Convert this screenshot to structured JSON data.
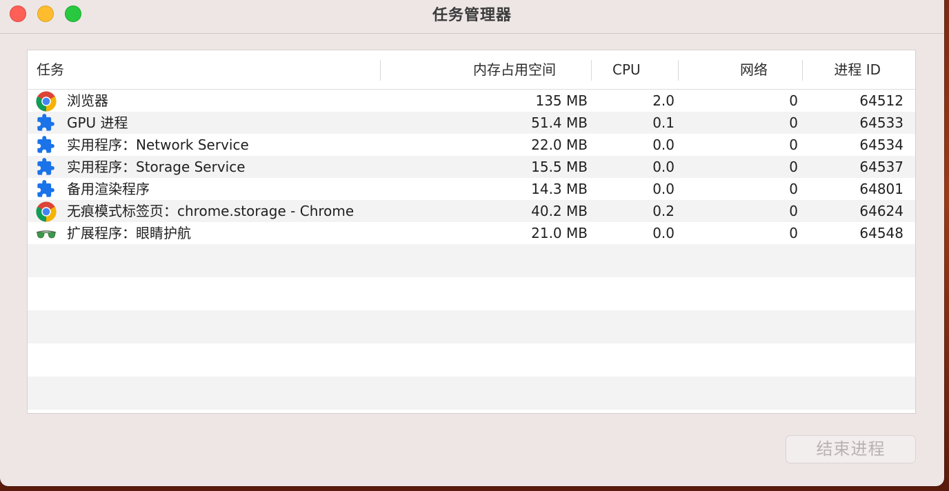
{
  "window": {
    "title": "任务管理器"
  },
  "columns": {
    "task": "任务",
    "memory": "内存占用空间",
    "cpu": "CPU",
    "network": "网络",
    "pid": "进程 ID"
  },
  "rows": [
    {
      "icon": "chrome-icon",
      "name": "浏览器",
      "memory": "135 MB",
      "cpu": "2.0",
      "network": "0",
      "pid": "64512"
    },
    {
      "icon": "puzzle-piece-icon",
      "name": "GPU 进程",
      "memory": "51.4 MB",
      "cpu": "0.1",
      "network": "0",
      "pid": "64533"
    },
    {
      "icon": "puzzle-piece-icon",
      "name": "实用程序：Network Service",
      "memory": "22.0 MB",
      "cpu": "0.0",
      "network": "0",
      "pid": "64534"
    },
    {
      "icon": "puzzle-piece-icon",
      "name": "实用程序：Storage Service",
      "memory": "15.5 MB",
      "cpu": "0.0",
      "network": "0",
      "pid": "64537"
    },
    {
      "icon": "puzzle-piece-icon",
      "name": "备用渲染程序",
      "memory": "14.3 MB",
      "cpu": "0.0",
      "network": "0",
      "pid": "64801"
    },
    {
      "icon": "chrome-icon",
      "name": "无痕模式标签页：chrome.storage - Chrome",
      "memory": "40.2 MB",
      "cpu": "0.2",
      "network": "0",
      "pid": "64624"
    },
    {
      "icon": "glasses-icon",
      "name": "扩展程序：眼睛护航",
      "memory": "21.0 MB",
      "cpu": "0.0",
      "network": "0",
      "pid": "64548"
    }
  ],
  "buttons": {
    "end_process": "结束进程"
  },
  "colors": {
    "close": "#fe5f57",
    "minimize": "#febc2e",
    "maximize": "#28c840",
    "extension_blue": "#1a73e8"
  }
}
